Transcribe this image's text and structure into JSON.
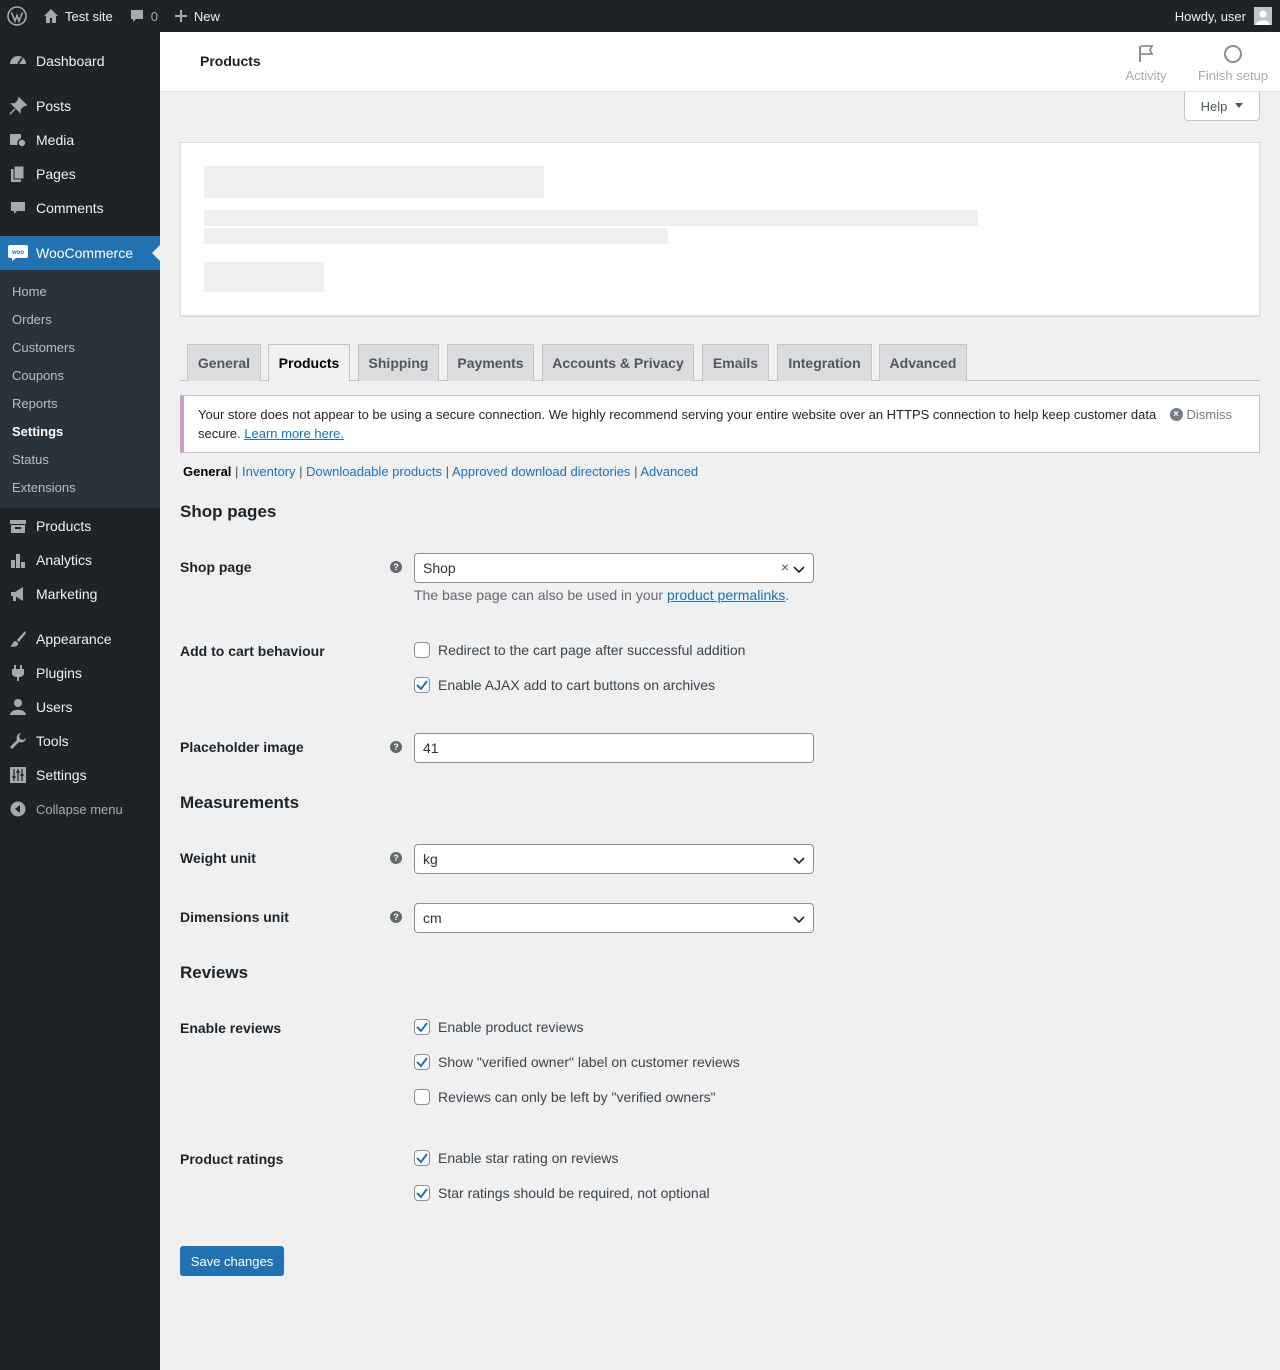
{
  "adminbar": {
    "site_name": "Test site",
    "comments_count": "0",
    "new_label": "New",
    "howdy": "Howdy, user"
  },
  "sidebar": {
    "items": [
      {
        "label": "Dashboard",
        "icon": "dashboard-icon"
      },
      {
        "label": "Posts",
        "icon": "pin-icon"
      },
      {
        "label": "Media",
        "icon": "media-icon"
      },
      {
        "label": "Pages",
        "icon": "pages-icon"
      },
      {
        "label": "Comments",
        "icon": "comment-icon"
      },
      {
        "label": "WooCommerce",
        "icon": "woo-icon"
      },
      {
        "label": "Products",
        "icon": "archive-icon"
      },
      {
        "label": "Analytics",
        "icon": "bar-chart-icon"
      },
      {
        "label": "Marketing",
        "icon": "megaphone-icon"
      },
      {
        "label": "Appearance",
        "icon": "brush-icon"
      },
      {
        "label": "Plugins",
        "icon": "plug-icon"
      },
      {
        "label": "Users",
        "icon": "user-icon"
      },
      {
        "label": "Tools",
        "icon": "wrench-icon"
      },
      {
        "label": "Settings",
        "icon": "sliders-icon"
      }
    ],
    "woo_submenu": [
      "Home",
      "Orders",
      "Customers",
      "Coupons",
      "Reports",
      "Settings",
      "Status",
      "Extensions"
    ],
    "collapse_label": "Collapse menu"
  },
  "header": {
    "title": "Products",
    "activity": "Activity",
    "finish_setup": "Finish setup"
  },
  "help_label": "Help",
  "tabs": [
    "General",
    "Products",
    "Shipping",
    "Payments",
    "Accounts & Privacy",
    "Emails",
    "Integration",
    "Advanced"
  ],
  "active_tab": "Products",
  "notice": {
    "text": "Your store does not appear to be using a secure connection. We highly recommend serving your entire website over an HTTPS connection to help keep customer data secure.",
    "link": "Learn more here.",
    "dismiss": "Dismiss"
  },
  "subsections": [
    "General",
    "Inventory",
    "Downloadable products",
    "Approved download directories",
    "Advanced"
  ],
  "shop_pages": {
    "heading": "Shop pages",
    "shop_page_label": "Shop page",
    "shop_page_value": "Shop",
    "shop_page_desc": "The base page can also be used in your",
    "shop_page_desc_link": "product permalinks",
    "add_to_cart_label": "Add to cart behaviour",
    "redirect_label": "Redirect to the cart page after successful addition",
    "redirect_checked": false,
    "ajax_label": "Enable AJAX add to cart buttons on archives",
    "ajax_checked": true,
    "placeholder_label": "Placeholder image",
    "placeholder_value": "41"
  },
  "measurements": {
    "heading": "Measurements",
    "weight_label": "Weight unit",
    "weight_value": "kg",
    "dimensions_label": "Dimensions unit",
    "dimensions_value": "cm"
  },
  "reviews": {
    "heading": "Reviews",
    "enable_label": "Enable reviews",
    "opt_product_reviews": "Enable product reviews",
    "opt_verified_label": "Show \"verified owner\" label on customer reviews",
    "opt_verified_only": "Reviews can only be left by \"verified owners\"",
    "ratings_label": "Product ratings",
    "opt_star_rating": "Enable star rating on reviews",
    "opt_star_required": "Star ratings should be required, not optional",
    "checks": {
      "product_reviews": true,
      "verified_label": true,
      "verified_only": false,
      "star_rating": true,
      "star_required": true
    }
  },
  "save_label": "Save changes",
  "colors": {
    "accent": "#2271b1",
    "adminbar": "#1d2327",
    "notice_border": "#c9a0c8"
  }
}
